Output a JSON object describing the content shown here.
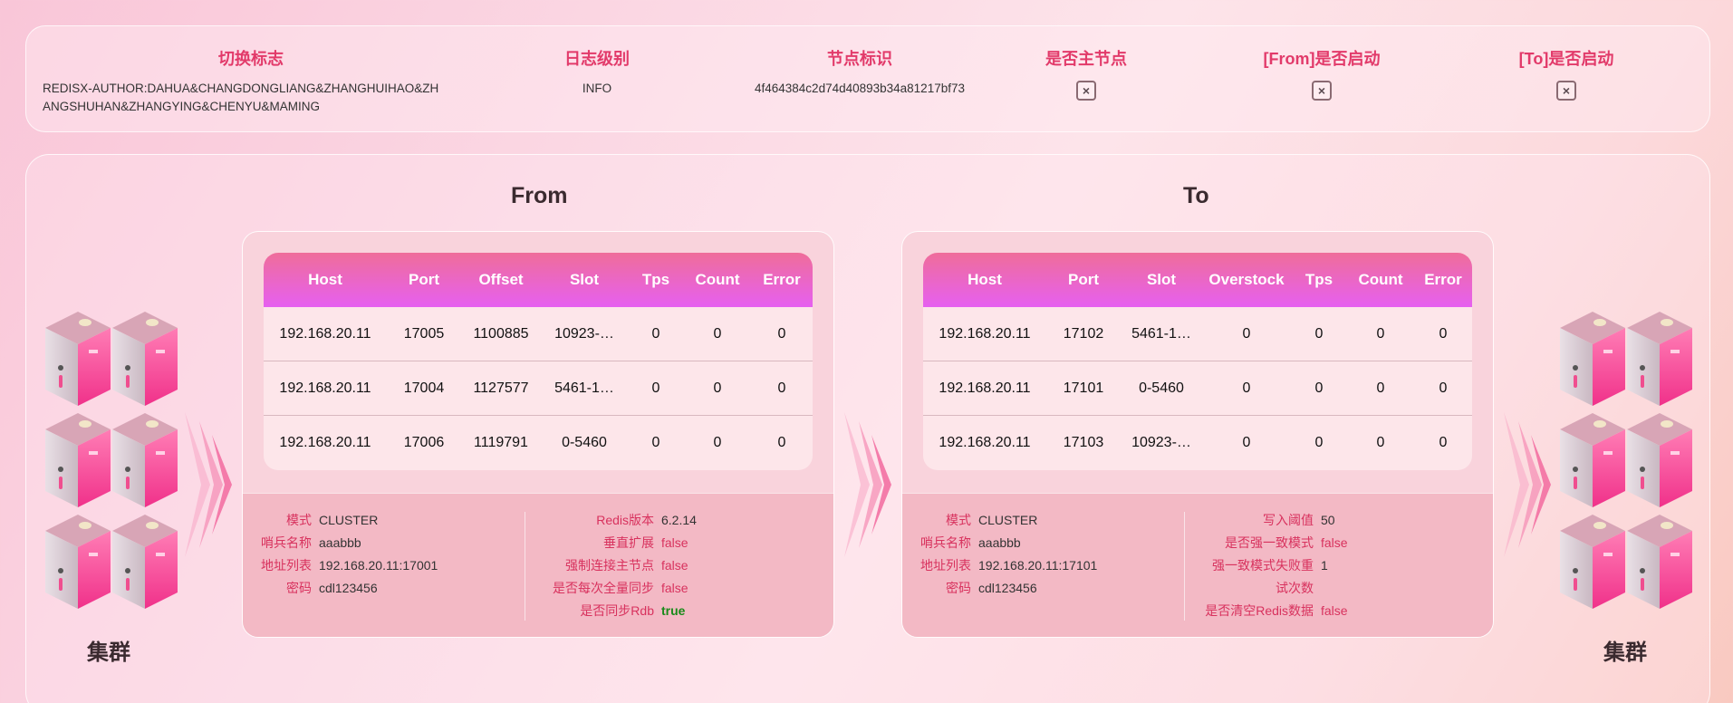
{
  "header": {
    "columns": [
      {
        "title": "切换标志",
        "value_lines": [
          "REDISX-AUTHOR:DAHUA&CHANGDONGLIANG&ZHANGHUIHAO&ZH",
          "ANGSHUHAN&ZHANGYING&CHENYU&MAMING"
        ]
      },
      {
        "title": "日志级别",
        "value": "INFO"
      },
      {
        "title": "节点标识",
        "value": "4f464384c2d74d40893b34a81217bf73"
      },
      {
        "title": "是否主节点",
        "checkbox": "×"
      },
      {
        "title": "[From]是否启动",
        "checkbox": "×"
      },
      {
        "title": "[To]是否启动",
        "checkbox": "×"
      }
    ]
  },
  "from": {
    "title": "From",
    "columns": [
      "Host",
      "Port",
      "Offset",
      "Slot",
      "Tps",
      "Count",
      "Error"
    ],
    "rows": [
      [
        "192.168.20.11",
        "17005",
        "1100885",
        "10923-…",
        "0",
        "0",
        "0"
      ],
      [
        "192.168.20.11",
        "17004",
        "1127577",
        "5461-1…",
        "0",
        "0",
        "0"
      ],
      [
        "192.168.20.11",
        "17006",
        "1119791",
        "0-5460",
        "0",
        "0",
        "0"
      ]
    ],
    "left_info": [
      {
        "k": "模式",
        "v": "CLUSTER"
      },
      {
        "k": "哨兵名称",
        "v": "aaabbb"
      },
      {
        "k": "地址列表",
        "v": "192.168.20.11:17001"
      },
      {
        "k": "密码",
        "v": "cdl123456"
      }
    ],
    "right_info": [
      {
        "k": "Redis版本",
        "v": "6.2.14"
      },
      {
        "k": "垂直扩展",
        "v": "false"
      },
      {
        "k": "强制连接主节点",
        "v": "false"
      },
      {
        "k": "是否每次全量同步",
        "v": "false"
      },
      {
        "k": "是否同步Rdb",
        "v": "true"
      }
    ]
  },
  "to": {
    "title": "To",
    "columns": [
      "Host",
      "Port",
      "Slot",
      "Overstock",
      "Tps",
      "Count",
      "Error"
    ],
    "rows": [
      [
        "192.168.20.11",
        "17102",
        "5461-1…",
        "0",
        "0",
        "0",
        "0"
      ],
      [
        "192.168.20.11",
        "17101",
        "0-5460",
        "0",
        "0",
        "0",
        "0"
      ],
      [
        "192.168.20.11",
        "17103",
        "10923-…",
        "0",
        "0",
        "0",
        "0"
      ]
    ],
    "left_info": [
      {
        "k": "模式",
        "v": "CLUSTER"
      },
      {
        "k": "哨兵名称",
        "v": "aaabbb"
      },
      {
        "k": "地址列表",
        "v": "192.168.20.11:17101"
      },
      {
        "k": "密码",
        "v": "cdl123456"
      }
    ],
    "right_info": [
      {
        "k": "写入阈值",
        "v": "50"
      },
      {
        "k": "是否强一致模式",
        "v": "false"
      },
      {
        "k": "强一致模式失败重试次数",
        "v": "1"
      },
      {
        "k": "是否清空Redis数据",
        "v": "false"
      }
    ]
  },
  "cluster_left_label": "集群",
  "cluster_right_label": "集群",
  "colors": {
    "accent": "#e23a6a",
    "header_gradient_top": "#ef6d9a",
    "header_gradient_bottom": "#e660f0",
    "true_color": "#1a8a1a"
  },
  "icons": {
    "server": "server-icon",
    "arrow": "chevron-right-icon",
    "checkbox": "close-icon"
  }
}
